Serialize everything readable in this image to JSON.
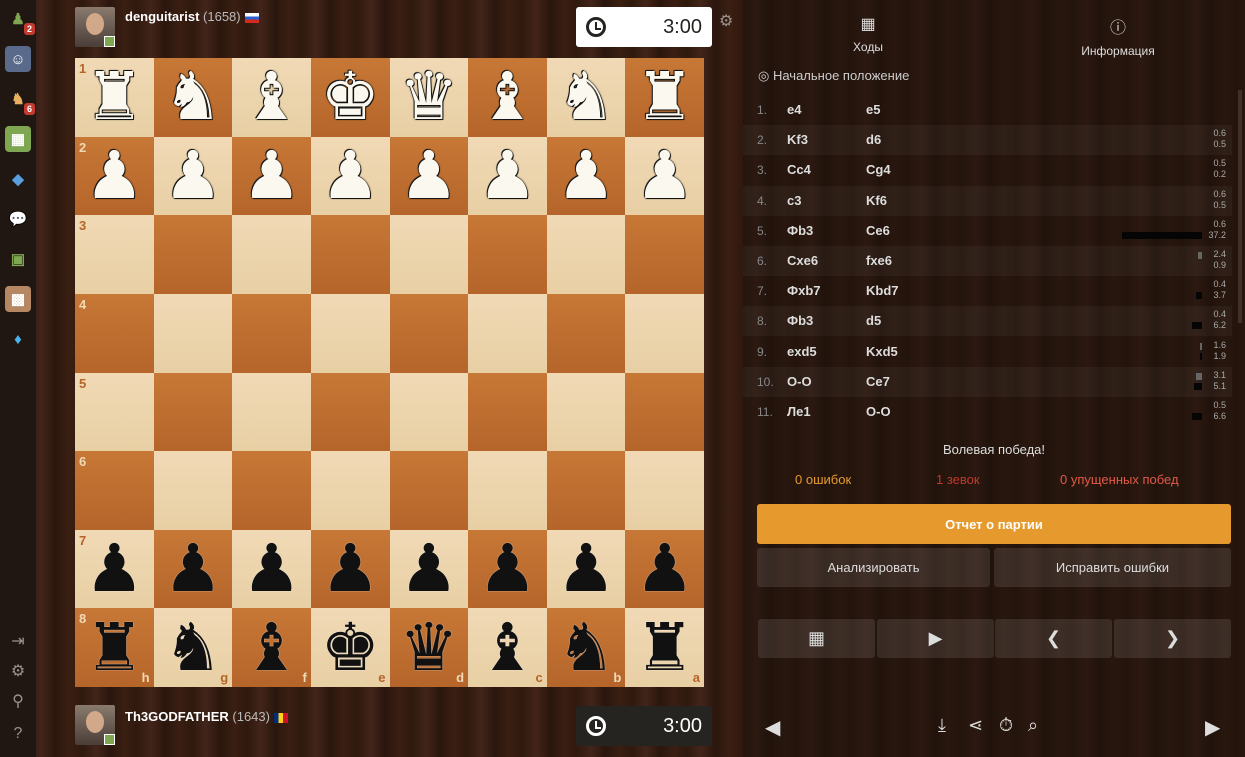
{
  "sidebar": {
    "badges": {
      "play": "2",
      "puzzles": "6"
    }
  },
  "top_player": {
    "name": "denguitarist",
    "rating": "(1658)",
    "clock": "3:00"
  },
  "bottom_player": {
    "name": "Th3GODFATHER",
    "rating": "(1643)",
    "clock": "3:00"
  },
  "board": {
    "ranks": [
      "1",
      "2",
      "3",
      "4",
      "5",
      "6",
      "7",
      "8"
    ],
    "files": [
      "h",
      "g",
      "f",
      "e",
      "d",
      "c",
      "b",
      "a"
    ],
    "rows": [
      [
        "wR",
        "wN",
        "wB",
        "wK",
        "wQ",
        "wB",
        "wN",
        "wR"
      ],
      [
        "wP",
        "wP",
        "wP",
        "wP",
        "wP",
        "wP",
        "wP",
        "wP"
      ],
      [
        "",
        "",
        "",
        "",
        "",
        "",
        "",
        ""
      ],
      [
        "",
        "",
        "",
        "",
        "",
        "",
        "",
        ""
      ],
      [
        "",
        "",
        "",
        "",
        "",
        "",
        "",
        ""
      ],
      [
        "",
        "",
        "",
        "",
        "",
        "",
        "",
        ""
      ],
      [
        "bP",
        "bP",
        "bP",
        "bP",
        "bP",
        "bP",
        "bP",
        "bP"
      ],
      [
        "bR",
        "bN",
        "bB",
        "bK",
        "bQ",
        "bB",
        "bN",
        "bR"
      ]
    ]
  },
  "tabs": {
    "moves": "Ходы",
    "info": "Информация"
  },
  "start_position": "Начальное положение",
  "moves": [
    {
      "n": "1.",
      "w": "e4",
      "b": "e5",
      "t": [
        "",
        ""
      ],
      "tb": 0,
      "bb": 0
    },
    {
      "n": "2.",
      "w": "Kf3",
      "b": "d6",
      "t": [
        "0.6",
        "0.5"
      ],
      "tb": 0,
      "bb": 0
    },
    {
      "n": "3.",
      "w": "Cc4",
      "b": "Cg4",
      "t": [
        "0.5",
        "0.2"
      ],
      "tb": 0,
      "bb": 0
    },
    {
      "n": "4.",
      "w": "c3",
      "b": "Kf6",
      "t": [
        "0.6",
        "0.5"
      ],
      "tb": 0,
      "bb": 0
    },
    {
      "n": "5.",
      "w": "Фb3",
      "b": "Ce6",
      "t": [
        "0.6",
        "37.2"
      ],
      "tb": 0,
      "bb": 80
    },
    {
      "n": "6.",
      "w": "Cxe6",
      "b": "fxe6",
      "t": [
        "2.4",
        "0.9"
      ],
      "tb": 4,
      "bb": 0
    },
    {
      "n": "7.",
      "w": "Фxb7",
      "b": "Kbd7",
      "t": [
        "0.4",
        "3.7"
      ],
      "tb": 0,
      "bb": 6
    },
    {
      "n": "8.",
      "w": "Фb3",
      "b": "d5",
      "t": [
        "0.4",
        "6.2"
      ],
      "tb": 0,
      "bb": 10
    },
    {
      "n": "9.",
      "w": "exd5",
      "b": "Kxd5",
      "t": [
        "1.6",
        "1.9"
      ],
      "tb": 2,
      "bb": 2
    },
    {
      "n": "10.",
      "w": "O-O",
      "b": "Ce7",
      "t": [
        "3.1",
        "5.1"
      ],
      "tb": 6,
      "bb": 8
    },
    {
      "n": "11.",
      "w": "Ле1",
      "b": "O-O",
      "t": [
        "0.5",
        "6.6"
      ],
      "tb": 0,
      "bb": 10
    }
  ],
  "result": "Волевая победа!",
  "stats": {
    "mistakes": "0 ошибок",
    "blunders": "1 зевок",
    "missed": "0 упущенных побед"
  },
  "buttons": {
    "report": "Отчет о партии",
    "analyze": "Анализировать",
    "fix": "Исправить ошибки"
  },
  "colors": {
    "report": "#e69a2e",
    "mistakes": "#e69a2e",
    "blunders": "#c0392b",
    "missed": "#e05a45",
    "clock_active": "#ffffff",
    "clock_inactive": "#262421"
  }
}
